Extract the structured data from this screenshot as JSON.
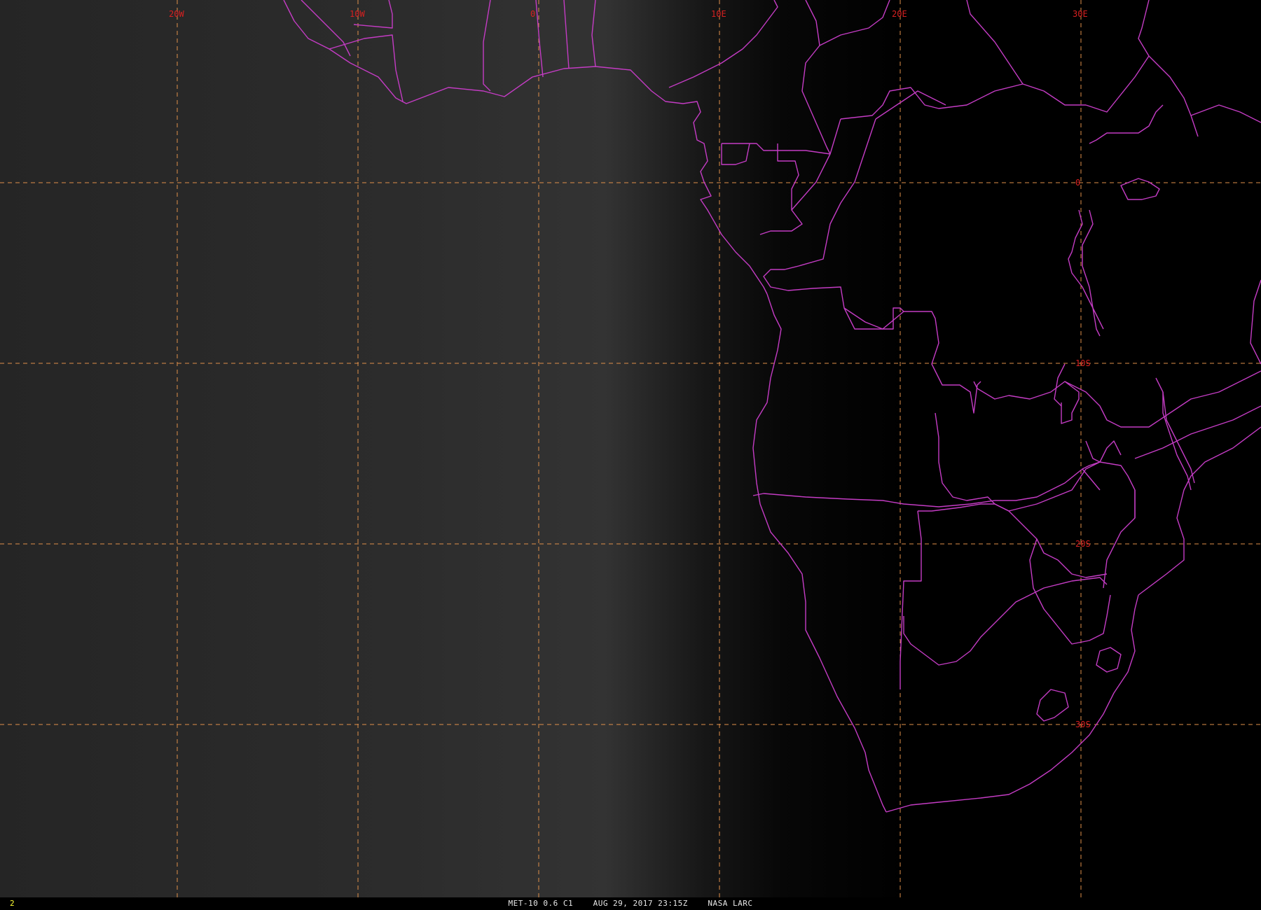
{
  "image": {
    "satellite": "MET-10",
    "channel": "0.6",
    "caption": "MET-10 0.6 C1    AUG 29, 2017 23:15Z    NASA LARC",
    "frame_number": "2"
  },
  "graticule": {
    "longitude_labels": [
      "20W",
      "10W",
      "0",
      "10E",
      "20E",
      "30E"
    ],
    "latitude_labels": [
      "0",
      "10S",
      "20S",
      "30S"
    ]
  },
  "colors": {
    "background_lit": "#2e2e2e",
    "background_dark": "#000000",
    "borders": "#c43cc4",
    "grid_lines": "#e0904a",
    "grid_labels": "#d82020",
    "frame_number": "#ffff33"
  }
}
